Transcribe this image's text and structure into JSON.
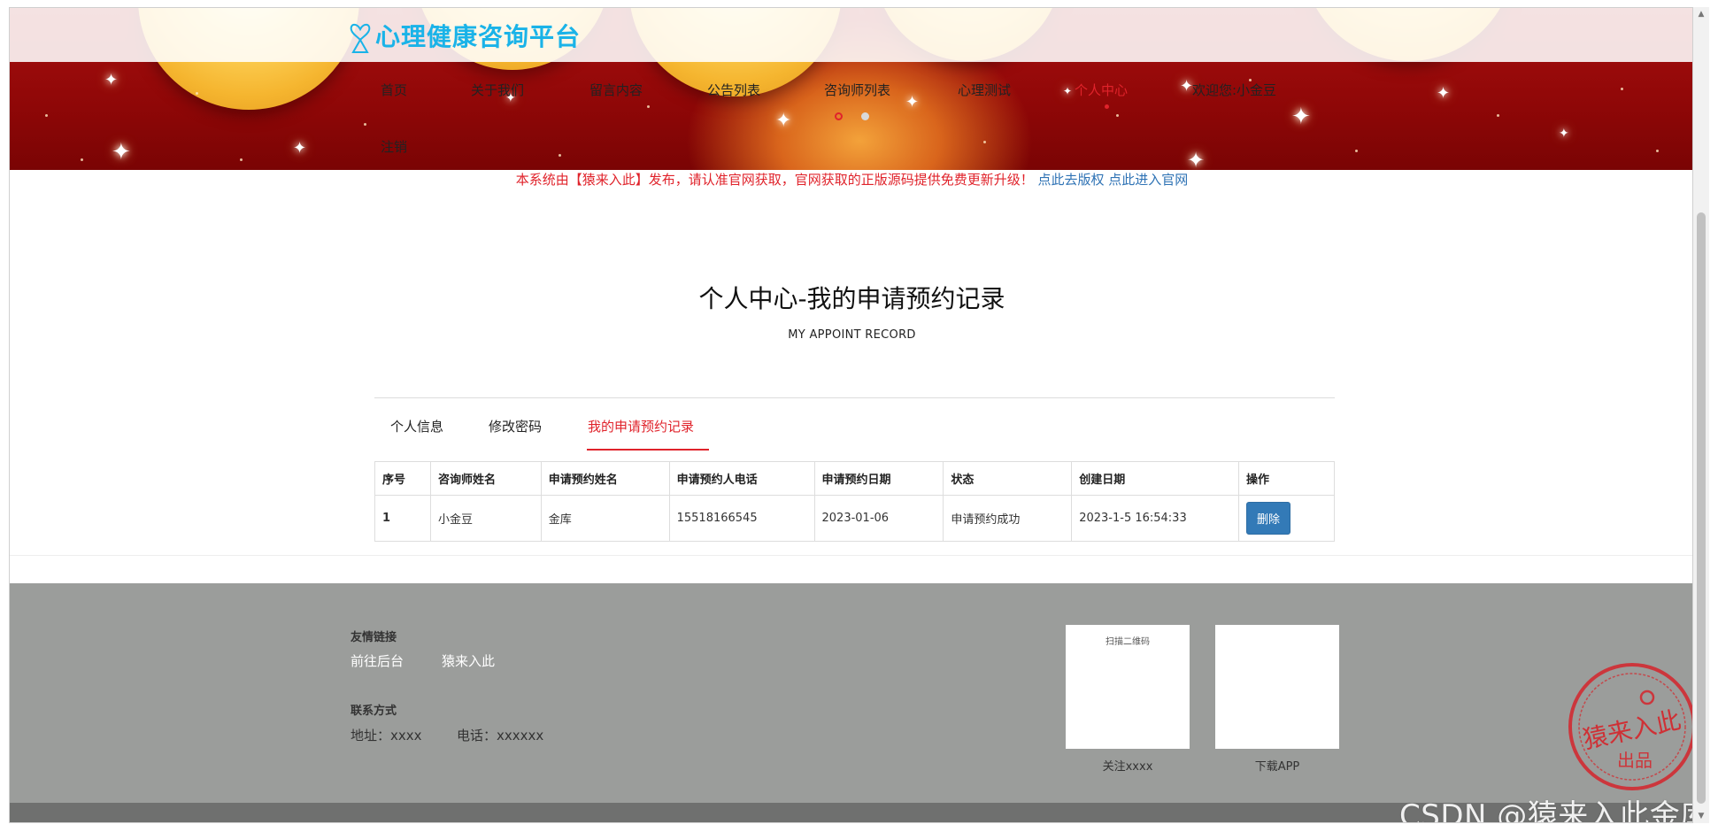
{
  "brand": {
    "logo_text": "心理健康咨询平台",
    "logo_color": "#1ab3e8"
  },
  "nav": {
    "items": [
      {
        "label": "首页",
        "key": "home"
      },
      {
        "label": "关于我们",
        "key": "about"
      },
      {
        "label": "留言内容",
        "key": "messages"
      },
      {
        "label": "公告列表",
        "key": "notices"
      },
      {
        "label": "咨询师列表",
        "key": "counselors"
      },
      {
        "label": "心理测试",
        "key": "tests"
      },
      {
        "label": "个人中心",
        "key": "profile",
        "active": true
      },
      {
        "label": "欢迎您:小金豆",
        "key": "welcome"
      },
      {
        "label": "注销",
        "key": "logout"
      }
    ],
    "active_color": "#e0232b"
  },
  "notice": {
    "text": "本系统由【猿来入此】发布，请认准官网获取，官网获取的正版源码提供免费更新升级！",
    "link1": "点此去版权",
    "link2": "点此进入官网"
  },
  "page": {
    "title": "个人中心-我的申请预约记录",
    "subtitle": "MY APPOINT RECORD"
  },
  "tabs": [
    {
      "label": "个人信息"
    },
    {
      "label": "修改密码"
    },
    {
      "label": "我的申请预约记录",
      "active": true
    }
  ],
  "table": {
    "headers": [
      "序号",
      "咨询师姓名",
      "申请预约姓名",
      "申请预约人电话",
      "申请预约日期",
      "状态",
      "创建日期",
      "操作"
    ],
    "rows": [
      {
        "index": "1",
        "counselor": "小金豆",
        "applicant": "金库",
        "phone": "15518166545",
        "date": "2023-01-06",
        "status": "申请预约成功",
        "created": "2023-1-5 16:54:33",
        "action_label": "删除"
      }
    ]
  },
  "footer": {
    "links_heading": "友情链接",
    "links": [
      "前往后台",
      "猿来入此"
    ],
    "contact_heading": "联系方式",
    "address": "地址：xxxx",
    "phone": "电话：xxxxxx",
    "qr1_title": "扫描二维码",
    "qr1_caption": "关注xxxx",
    "qr2_caption": "下载APP",
    "background": "#9b9d9b"
  },
  "seal": {
    "text_main": "猿来入此",
    "text_sub": "出品"
  },
  "watermark": "CSDN @猿来入此金库"
}
